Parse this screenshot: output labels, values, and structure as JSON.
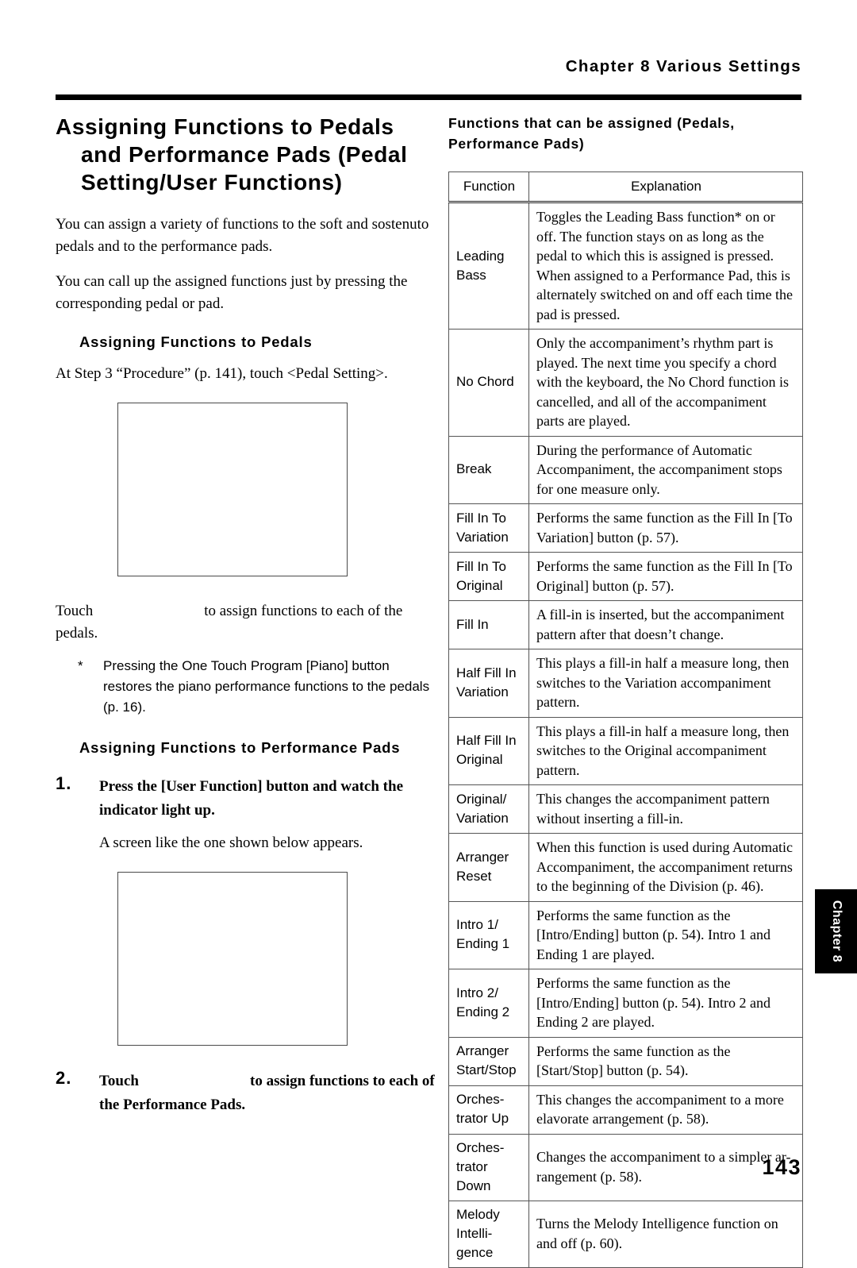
{
  "running_head": "Chapter 8 Various Settings",
  "left_column": {
    "title": "Assigning Functions to Pedals and Performance Pads (Pedal Setting/User Functions)",
    "intro_paragraph_1": "You can assign a variety of functions to the soft and sostenuto pedals and to the performance pads.",
    "intro_paragraph_2": "You can call up the assigned functions just by pressing the corresponding pedal or pad.",
    "section_pedals_heading": "Assigning Functions to Pedals",
    "section_pedals_line": "At Step 3 “Procedure” (p. 141), touch <Pedal Setting>.",
    "touch_line_prefix": "Touch",
    "touch_line_suffix": "to assign functions to each of the pedals.",
    "note_marker": "*",
    "note_text": "Pressing the One Touch Program [Piano] button restores the piano performance functions to the pedals (p. 16).",
    "section_pads_heading": "Assigning Functions to Performance Pads",
    "step1_number": "1.",
    "step1_text": "Press the [User Function] button and watch the indicator light up.",
    "step1_follow": "A screen like the one shown below appears.",
    "step2_number": "2.",
    "step2_text_prefix": "Touch",
    "step2_text_suffix": "to assign functions to each of the Performance Pads."
  },
  "right_column": {
    "heading": "Functions that can be assigned (Pedals, Performance Pads)",
    "table": {
      "columns": [
        "Function",
        "Explanation"
      ],
      "rows": [
        {
          "function": "Leading Bass",
          "explanation": "Toggles the Leading Bass function* on or off. The function stays on as long as the pedal to which this is assigned is pressed.\nWhen assigned to a Performance Pad, this is alternately switched on and off each time the pad is pressed."
        },
        {
          "function": "No Chord",
          "explanation": "Only the accompaniment’s rhythm part is played. The next time you specify a chord with the keyboard, the No Chord function is cancelled, and all of the accompaniment parts are played."
        },
        {
          "function": "Break",
          "explanation": "During the performance of Automatic Accompaniment, the accompaniment stops for one measure only."
        },
        {
          "function": "Fill In To Variation",
          "explanation": "Performs the same function as the Fill In [To Variation] button (p. 57)."
        },
        {
          "function": "Fill In To Original",
          "explanation": "Performs the same function as the Fill In [To Original] button (p. 57)."
        },
        {
          "function": "Fill In",
          "explanation": "A fill-in is inserted, but the accompaniment pattern after that doesn’t change."
        },
        {
          "function": "Half Fill In Variation",
          "explanation": "This plays a fill-in half a measure long, then switches to the Variation accompaniment pattern."
        },
        {
          "function": "Half Fill In Original",
          "explanation": "This plays a fill-in half a measure long, then switches to the Original accompaniment pattern."
        },
        {
          "function": "Original/ Variation",
          "explanation": "This changes the accompaniment pattern without inserting a fill-in."
        },
        {
          "function": "Arranger Reset",
          "explanation": "When this function is used during Automatic Accompaniment, the accompaniment returns to the beginning of the Division (p. 46)."
        },
        {
          "function": "Intro 1/ Ending 1",
          "explanation": "Performs the same function as the [Intro/Ending] button (p. 54). Intro 1 and Ending 1 are played."
        },
        {
          "function": "Intro 2/ Ending 2",
          "explanation": "Performs the same function as the [Intro/Ending] button (p. 54). Intro 2 and Ending 2 are played."
        },
        {
          "function": "Arranger Start/Stop",
          "explanation": "Performs the same function as the [Start/Stop] button (p. 54)."
        },
        {
          "function": "Orches- trator Up",
          "explanation": "This changes the accompaniment to a more elavorate arrangement (p. 58)."
        },
        {
          "function": "Orches- trator Down",
          "explanation": "Changes the accompaniment to a simpler ar-rangement (p. 58)."
        },
        {
          "function": "Melody Intelli- gence",
          "explanation": "Turns the Melody Intelligence function on and off (p. 60)."
        }
      ]
    }
  },
  "chapter_tab": "Chapter 8",
  "page_number": "143"
}
